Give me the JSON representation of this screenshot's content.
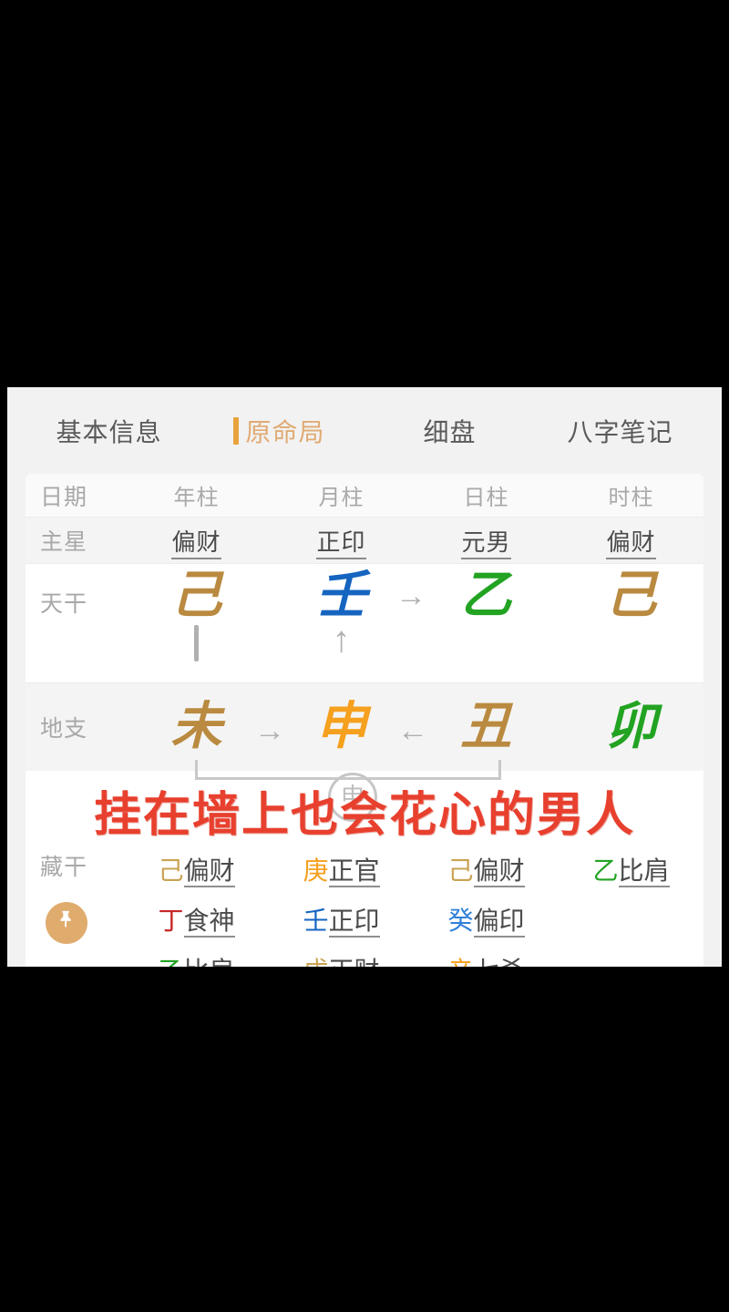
{
  "colors": {
    "tan": "#b98a40",
    "gold_light": "#c9a253",
    "blue": "#1565c0",
    "green": "#22a322",
    "orange": "#f5a01e",
    "red": "#c62828",
    "accent": "#e8a33d",
    "active_tab_text": "#e0ab74",
    "overlay_red": "#e8402e"
  },
  "tabs": [
    {
      "label": "基本信息",
      "active": false
    },
    {
      "label": "原命局",
      "active": true
    },
    {
      "label": "细盘",
      "active": false
    },
    {
      "label": "八字笔记",
      "active": false
    }
  ],
  "chart": {
    "header": {
      "label": "日期",
      "columns": [
        "年柱",
        "月柱",
        "日柱",
        "时柱"
      ]
    },
    "main_star": {
      "label": "主星",
      "values": [
        "偏财",
        "正印",
        "元男",
        "偏财"
      ]
    },
    "heavenly_stem": {
      "label": "天干",
      "values": [
        {
          "char": "己",
          "color": "#b98a40"
        },
        {
          "char": "壬",
          "color": "#1565c0"
        },
        {
          "char": "乙",
          "color": "#22a322"
        },
        {
          "char": "己",
          "color": "#b98a40"
        }
      ],
      "arrow_between_2_3": "→",
      "link_under_1": "line",
      "link_under_2": "↑"
    },
    "earthly_branch": {
      "label": "地支",
      "values": [
        {
          "char": "未",
          "color": "#b98a40"
        },
        {
          "char": "申",
          "color": "#f5a01e"
        },
        {
          "char": "丑",
          "color": "#b98a40"
        },
        {
          "char": "卯",
          "color": "#22a322"
        }
      ],
      "arrow_1_to_2": "→",
      "arrow_3_to_2": "←"
    },
    "circle_mark_char": "申",
    "hidden_stems": {
      "label": "藏干",
      "pin_icon": "pin-icon",
      "columns": [
        [
          {
            "stem": "己",
            "star": "偏财",
            "color": "#c9a253"
          },
          {
            "stem": "丁",
            "star": "食神",
            "color": "#c62828"
          },
          {
            "stem": "乙",
            "star": "比肩",
            "color": "#22a322"
          }
        ],
        [
          {
            "stem": "庚",
            "star": "正官",
            "color": "#f5a01e"
          },
          {
            "stem": "壬",
            "star": "正印",
            "color": "#1565c0"
          },
          {
            "stem": "戊",
            "star": "正财",
            "color": "#c9a253"
          }
        ],
        [
          {
            "stem": "己",
            "star": "偏财",
            "color": "#c9a253"
          },
          {
            "stem": "癸",
            "star": "偏印",
            "color": "#2f80d8"
          },
          {
            "stem": "辛",
            "star": "七杀",
            "color": "#f5a01e"
          }
        ],
        [
          {
            "stem": "乙",
            "star": "比肩",
            "color": "#22a322"
          }
        ]
      ]
    }
  },
  "overlay": {
    "text": "挂在墙上也会花心的男人"
  }
}
